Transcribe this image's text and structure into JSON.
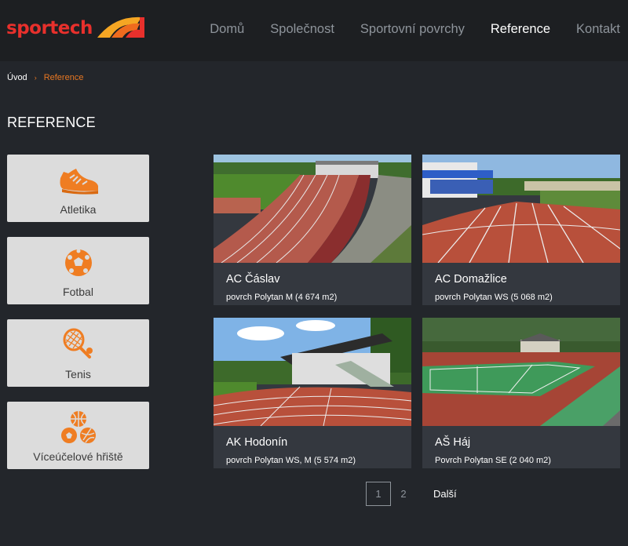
{
  "brand": {
    "name": "sportech",
    "accent": "#e8302c",
    "orange": "#e87722"
  },
  "nav": [
    {
      "label": "Domů",
      "active": false
    },
    {
      "label": "Společnost",
      "active": false
    },
    {
      "label": "Sportovní povrchy",
      "active": false
    },
    {
      "label": "Reference",
      "active": true
    },
    {
      "label": "Kontakt",
      "active": false
    }
  ],
  "breadcrumb": {
    "home": "Úvod",
    "separator": "›",
    "current": "Reference"
  },
  "page_title": "REFERENCE",
  "categories": [
    {
      "label": "Atletika",
      "icon": "running-shoe-icon"
    },
    {
      "label": "Fotbal",
      "icon": "soccer-ball-icon"
    },
    {
      "label": "Tenis",
      "icon": "tennis-racket-icon"
    },
    {
      "label": "Víceúčelové hřiště",
      "icon": "multi-ball-icon"
    }
  ],
  "references": [
    {
      "title": "AC Čáslav",
      "surface": "povrch Polytan M (4 674 m2)"
    },
    {
      "title": "AC Domažlice",
      "surface": "povrch Polytan WS (5 068 m2)"
    },
    {
      "title": "AK Hodonín",
      "surface": "povrch Polytan WS, M (5 574 m2)"
    },
    {
      "title": "AŠ Háj",
      "surface": "Povrch Polytan SE (2 040 m2)"
    }
  ],
  "pagination": {
    "pages": [
      "1",
      "2"
    ],
    "current": "1",
    "next": "Další"
  }
}
